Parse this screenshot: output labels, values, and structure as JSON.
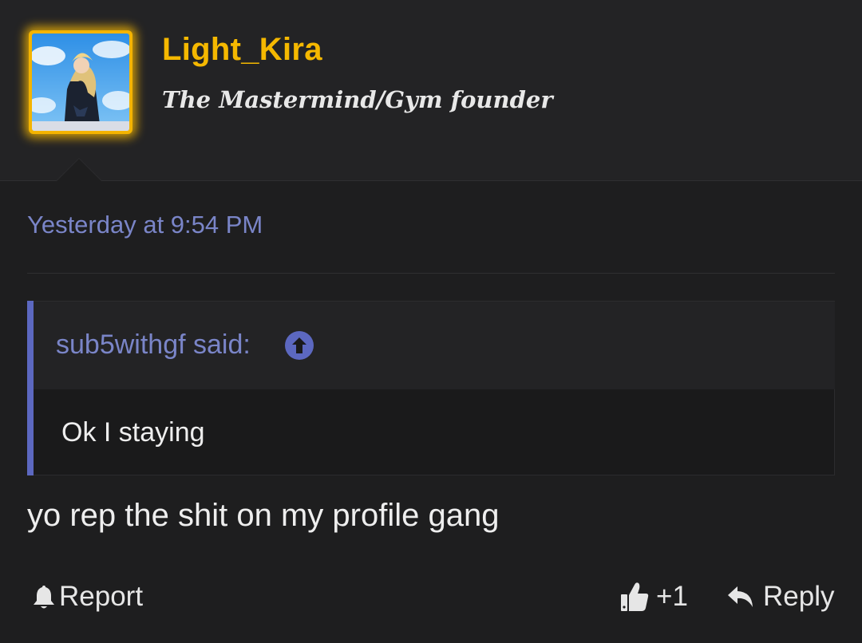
{
  "post": {
    "author": {
      "username": "Light_Kira",
      "title": "The Mastermind/Gym founder",
      "username_color": "#f5b800",
      "avatar_border_color": "#f4b400"
    },
    "timestamp": "Yesterday at 9:54 PM",
    "quote": {
      "author_label": "sub5withgf said:",
      "body": "Ok I staying",
      "accent_color": "#5c68c0",
      "jump_icon": "arrow-up-circle-icon"
    },
    "message": "yo rep the shit on my profile gang",
    "actions": {
      "report": {
        "label": "Report",
        "icon": "bell-icon"
      },
      "like": {
        "label": "+1",
        "icon": "thumbs-up-icon"
      },
      "reply": {
        "label": "Reply",
        "icon": "reply-arrow-icon"
      }
    }
  }
}
